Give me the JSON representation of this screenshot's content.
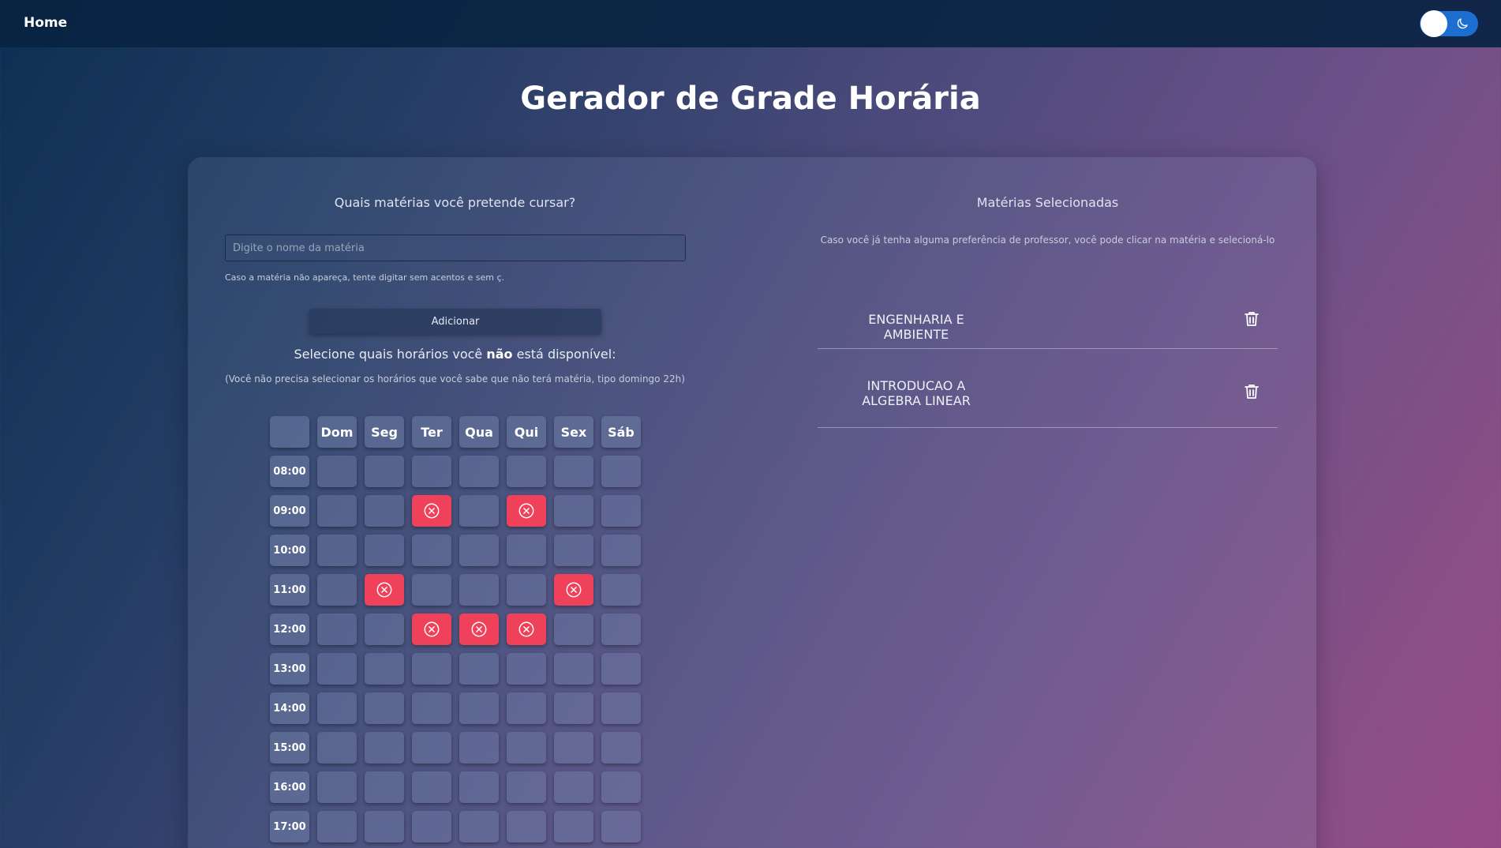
{
  "nav": {
    "home_label": "Home"
  },
  "page_title": "Gerador de Grade Horária",
  "left": {
    "heading": "Quais matérias você pretende cursar?",
    "input_placeholder": "Digite o nome da matéria",
    "input_value": "",
    "hint": "Caso a matéria não apareça, tente digitar sem acentos e sem ç.",
    "add_label": "Adicionar",
    "availability_prefix": "Selecione quais horários você ",
    "availability_bold": "não",
    "availability_suffix": " está disponível:",
    "availability_note": "(Você não precisa selecionar os horários que você sabe que não terá matéria, tipo domingo 22h)"
  },
  "grid": {
    "days": [
      "Dom",
      "Seg",
      "Ter",
      "Qua",
      "Qui",
      "Sex",
      "Sáb"
    ],
    "times": [
      "08:00",
      "09:00",
      "10:00",
      "11:00",
      "12:00",
      "13:00",
      "14:00",
      "15:00",
      "16:00",
      "17:00"
    ],
    "blocked": [
      [
        "09:00",
        "Ter"
      ],
      [
        "09:00",
        "Qui"
      ],
      [
        "11:00",
        "Seg"
      ],
      [
        "11:00",
        "Sex"
      ],
      [
        "12:00",
        "Ter"
      ],
      [
        "12:00",
        "Qua"
      ],
      [
        "12:00",
        "Qui"
      ]
    ],
    "blocked_color": "#f0415a"
  },
  "right": {
    "heading": "Matérias Selecionadas",
    "note": "Caso você já tenha alguma preferência de professor, você pode clicar na matéria e selecioná-lo",
    "subjects": [
      {
        "name": "ENGENHARIA E AMBIENTE"
      },
      {
        "name": "INTRODUCAO A ALGEBRA LINEAR"
      }
    ]
  },
  "icons": {
    "theme": "moon-icon",
    "blocked_slot": "x-circle-icon",
    "remove": "trash-icon"
  }
}
